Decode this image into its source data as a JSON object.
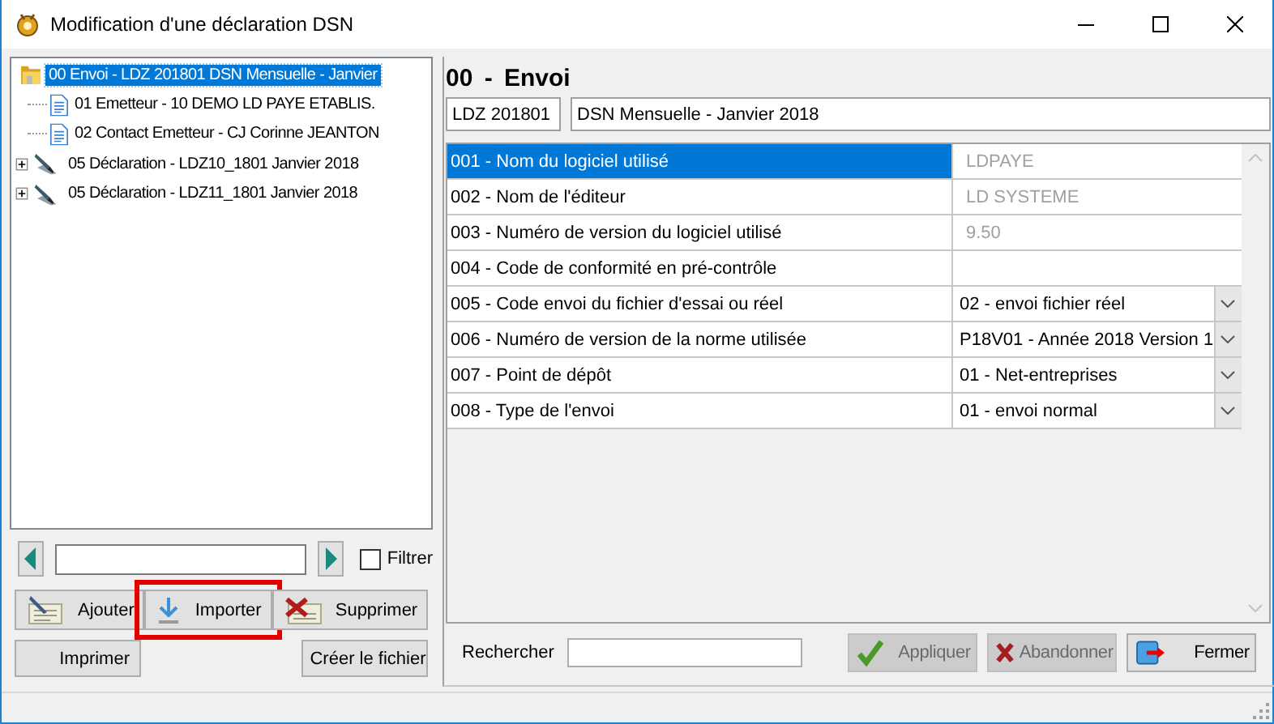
{
  "window": {
    "title": "Modification d'une déclaration DSN"
  },
  "tree": [
    {
      "label": "00 Envoi - LDZ 201801 DSN Mensuelle - Janvier",
      "kind": "folder",
      "selected": true,
      "children": [
        {
          "label": "01 Emetteur - 10 DEMO LD PAYE ETABLIS.",
          "kind": "document",
          "selected": false
        },
        {
          "label": "02 Contact Emetteur - CJ Corinne JEANTON",
          "kind": "document",
          "selected": false
        }
      ]
    },
    {
      "label": "05 Déclaration - LDZ10_1801 Janvier 2018",
      "kind": "declaration",
      "selected": false,
      "expanded": false
    },
    {
      "label": "05 Déclaration - LDZ11_1801 Janvier 2018",
      "kind": "declaration",
      "selected": false,
      "expanded": false
    }
  ],
  "navigator": {
    "filter": {
      "label": "Filtrer",
      "checked": false
    }
  },
  "button_rows": [
    [
      {
        "label": "Ajouter",
        "kind": "add",
        "highlighted": false
      },
      {
        "label": "Importer",
        "kind": "import",
        "highlighted": true
      },
      {
        "label": "Supprimer",
        "kind": "delete",
        "highlighted": false
      }
    ],
    [
      {
        "label": "Imprimer",
        "kind": "plain",
        "highlighted": false
      },
      {
        "label": "Créer le fichier",
        "kind": "plain",
        "highlighted": false
      }
    ]
  ],
  "section": {
    "title": "00 - Envoi",
    "code": "LDZ 201801",
    "description": "DSN Mensuelle - Janvier 2018"
  },
  "grid": {
    "rows": [
      {
        "label": "001 - Nom du logiciel utilisé",
        "value": "LDPAYE",
        "kind": "readonly",
        "selected": true
      },
      {
        "label": "002 - Nom de l'éditeur",
        "value": "LD SYSTEME",
        "kind": "readonly",
        "selected": false
      },
      {
        "label": "003 - Numéro de version du logiciel utilisé",
        "value": "9.50",
        "kind": "readonly",
        "selected": false
      },
      {
        "label": "004 - Code de conformité en pré-contrôle",
        "kind": "text",
        "selected": false
      },
      {
        "label": "005 - Code envoi du fichier d'essai ou réel",
        "value": "02 - envoi fichier réel",
        "kind": "dropdown",
        "selected": false
      },
      {
        "label": "006 - Numéro de version de la norme utilisée",
        "value": "P18V01 - Année 2018 Version 1",
        "kind": "dropdown",
        "selected": false
      },
      {
        "label": "007 - Point de dépôt",
        "value": "01 - Net-entreprises",
        "kind": "dropdown",
        "selected": false
      },
      {
        "label": "008 - Type de l'envoi",
        "value": "01 - envoi normal",
        "kind": "dropdown",
        "selected": false
      }
    ]
  },
  "search": {
    "label": "Rechercher"
  },
  "bottom_buttons": [
    {
      "label": "Appliquer",
      "kind": "apply",
      "disabled": true
    },
    {
      "label": "Abandonner",
      "kind": "cancel",
      "disabled": true
    },
    {
      "label": "Fermer",
      "kind": "close",
      "disabled": false
    }
  ]
}
